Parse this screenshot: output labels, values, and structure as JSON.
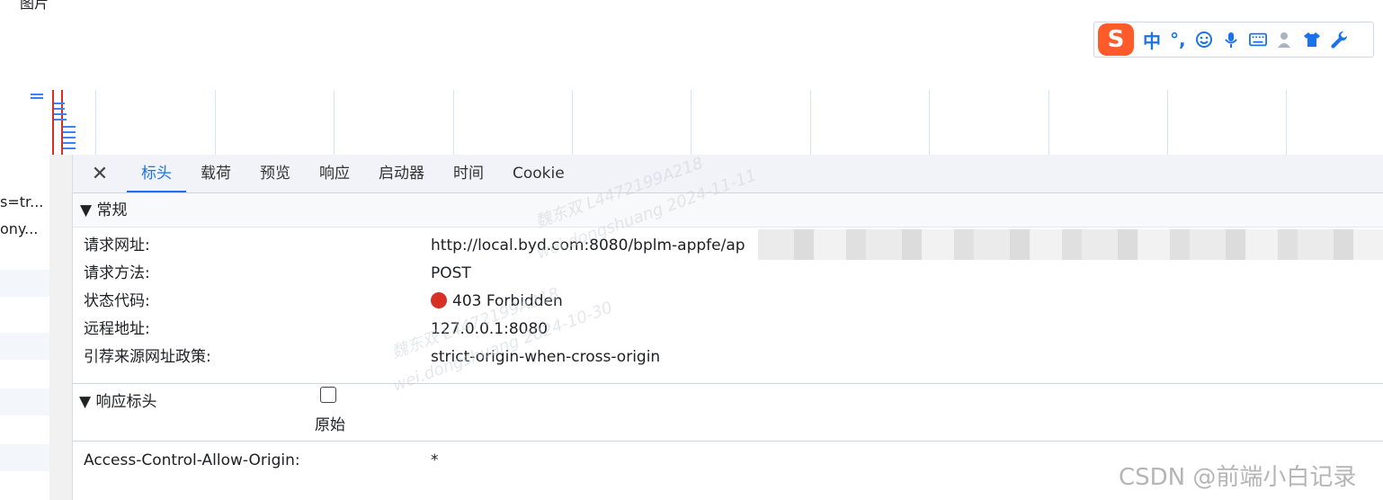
{
  "top": {
    "cut_label": "图片"
  },
  "ime": {
    "logo": "S",
    "lang": "中",
    "punct": "°,",
    "icons": [
      "smile-icon",
      "microphone-icon",
      "keyboard-icon",
      "user-icon",
      "shirt-icon",
      "wrench-icon"
    ]
  },
  "request_list": [
    "s=tr...",
    "ony..."
  ],
  "tabs": {
    "close": "✕",
    "items": [
      "标头",
      "载荷",
      "预览",
      "响应",
      "启动器",
      "时间",
      "Cookie"
    ],
    "active": "标头"
  },
  "general": {
    "title": "▼ 常规",
    "rows": [
      {
        "label": "请求网址:",
        "value": "http://local.byd.com:8080/bplm-appfe/ap"
      },
      {
        "label": "请求方法:",
        "value": "POST"
      },
      {
        "label": "状态代码:",
        "value": "403 Forbidden"
      },
      {
        "label": "远程地址:",
        "value": "127.0.0.1:8080"
      },
      {
        "label": "引荐来源网址政策:",
        "value": "strict-origin-when-cross-origin"
      }
    ]
  },
  "response_headers": {
    "title": "▼ 响应标头",
    "raw_label": "原始",
    "rows": [
      {
        "label": "Access-Control-Allow-Origin:",
        "value": "*"
      }
    ]
  },
  "watermarks": [
    "魏东双 L4472199A218",
    "wei.dongshuang 2024-11-11",
    "魏东双 L4472199A218",
    "wei.dongshuang 2024-10-30"
  ],
  "footer": {
    "brand": "CSDN @前端小白记录"
  },
  "colors": {
    "accent": "#1a73e8",
    "status_error": "#d93025",
    "ime_brand": "#ff5a2a"
  }
}
